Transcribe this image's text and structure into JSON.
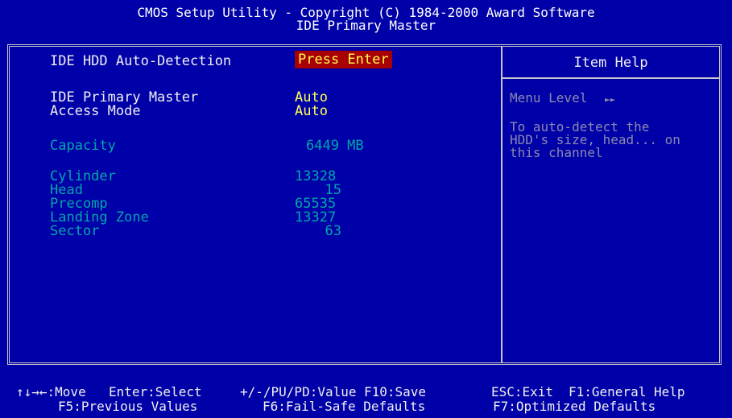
{
  "header": {
    "line1": "CMOS Setup Utility - Copyright (C) 1984-2000 Award Software",
    "line2": "IDE Primary Master"
  },
  "items": {
    "auto_detect": {
      "label": "IDE HDD Auto-Detection",
      "value": "Press Enter"
    },
    "primary_master": {
      "label": "IDE Primary Master",
      "value": "Auto"
    },
    "access_mode": {
      "label": "Access Mode",
      "value": "Auto"
    },
    "capacity": {
      "label": "Capacity",
      "value": "6449 MB"
    },
    "cylinder": {
      "label": "Cylinder",
      "value": "13328"
    },
    "head": {
      "label": "Head",
      "value": "15"
    },
    "precomp": {
      "label": "Precomp",
      "value": "65535"
    },
    "landing_zone": {
      "label": "Landing Zone",
      "value": "13327"
    },
    "sector": {
      "label": "Sector",
      "value": "63"
    }
  },
  "help": {
    "title": "Item Help",
    "menu_level": "Menu Level",
    "menu_arrows": "►►",
    "line1": "To auto-detect the",
    "line2": "HDD's size, head... on",
    "line3": "this channel"
  },
  "footer": {
    "move": "↑↓→←:Move",
    "select": "Enter:Select",
    "value": "+/-/PU/PD:Value",
    "save": "F10:Save",
    "exit": "ESC:Exit",
    "general_help": "F1:General Help",
    "prev_values": "F5:Previous Values",
    "failsafe": "F6:Fail-Safe Defaults",
    "optimized": "F7:Optimized Defaults"
  },
  "colors": {
    "background": "#0000a8",
    "highlight": "#a80000",
    "value_yellow": "#ffff54",
    "info_cyan": "#00a8a8"
  }
}
